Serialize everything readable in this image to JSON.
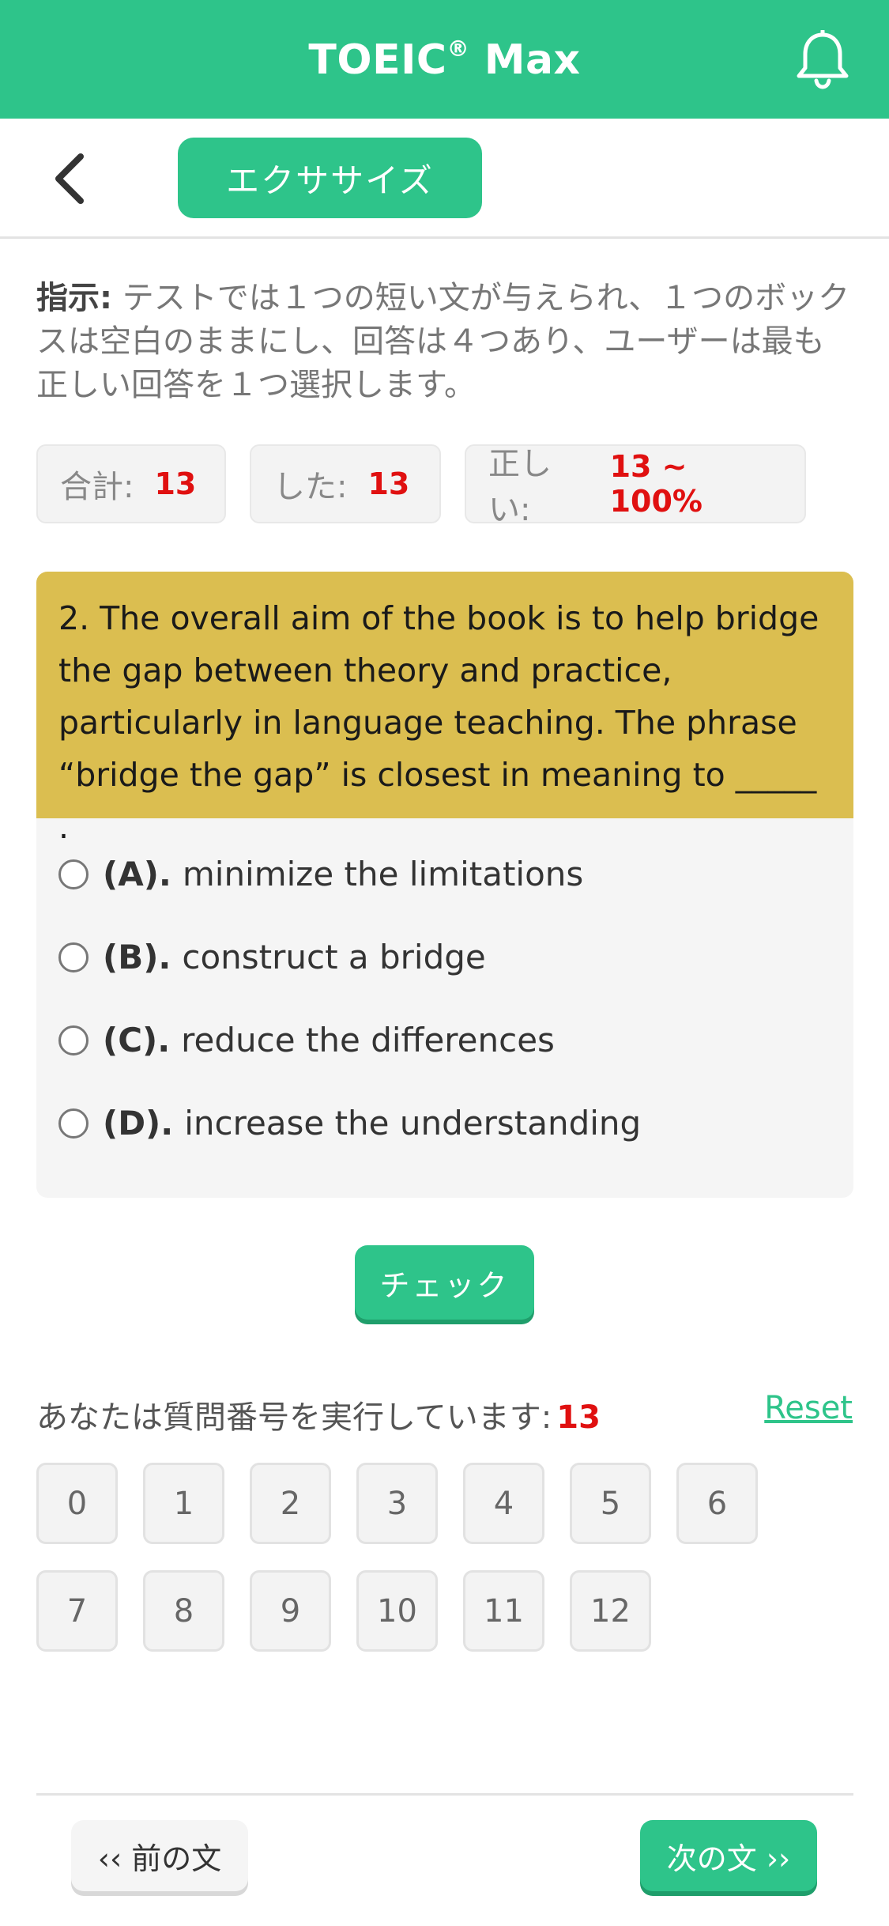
{
  "header": {
    "title": "TOEIC",
    "title_mark": "®",
    "title_suffix": " Max",
    "bell_icon": "bell-icon"
  },
  "nav": {
    "back_icon": "chevron-left-icon",
    "tab_label": "エクササイズ"
  },
  "instructions": {
    "label": "指示:",
    "text": " テストでは１つの短い文が与えられ、１つのボックスは空白のままにし、回答は４つあり、ユーザーは最も正しい回答を１つ選択します。"
  },
  "stats": {
    "total_label": "合計:",
    "total_value": "13",
    "done_label": "した:",
    "done_value": "13",
    "correct_label": "正しい:",
    "correct_value": "13 ~ 100%"
  },
  "question": {
    "text": "2. The overall aim of the book is to help bridge the gap between theory and practice, particularly in language teaching. The phrase “bridge the gap” is closest in meaning to _____ .",
    "options": [
      {
        "letter": "(A).",
        "text": "minimize the limitations"
      },
      {
        "letter": "(B).",
        "text": "construct a bridge"
      },
      {
        "letter": "(C).",
        "text": "reduce the differences"
      },
      {
        "letter": "(D).",
        "text": "increase the understanding"
      }
    ]
  },
  "check_label": "チェック",
  "progress": {
    "label": "あなたは質問番号を実行しています:",
    "current": "13",
    "reset_label": "Reset",
    "numbers": [
      "0",
      "1",
      "2",
      "3",
      "4",
      "5",
      "6",
      "7",
      "8",
      "9",
      "10",
      "11",
      "12"
    ]
  },
  "footer": {
    "prev_label": "‹‹ 前の文",
    "next_label": "次の文 ››"
  },
  "colors": {
    "accent": "#2ec48a",
    "question_bg": "#dbbe50",
    "highlight": "#e01010"
  }
}
